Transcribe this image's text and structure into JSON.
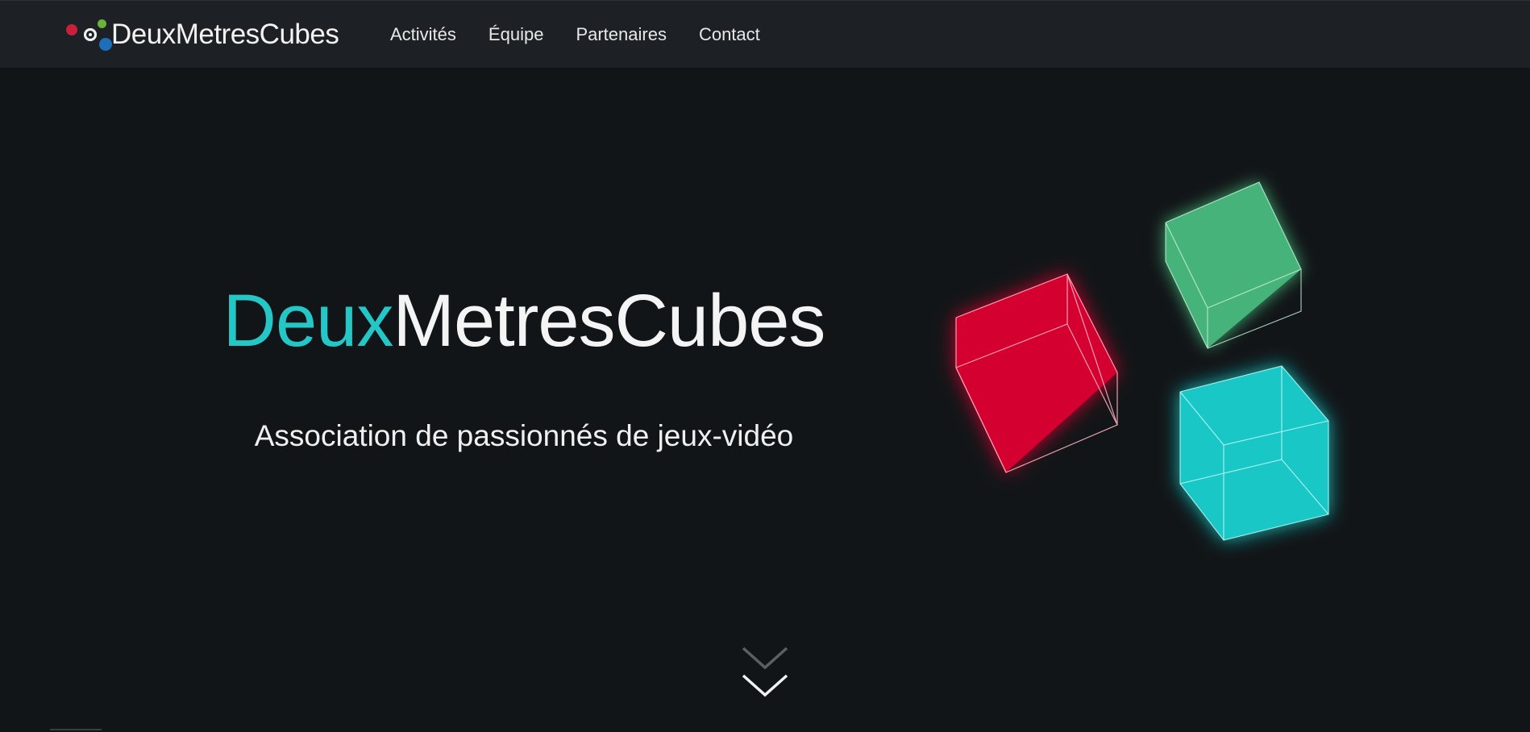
{
  "navbar": {
    "brand": "DeuxMetresCubes",
    "links": [
      {
        "label": "Activités"
      },
      {
        "label": "Équipe"
      },
      {
        "label": "Partenaires"
      },
      {
        "label": "Contact"
      }
    ]
  },
  "hero": {
    "title_accent": "Deux",
    "title_main": "MetresCubes",
    "subtitle": "Association de passionnés de jeux-vidéo"
  },
  "colors": {
    "background": "#121518",
    "navbar": "#1d2125",
    "accent": "#24c6c6",
    "cube_red": "#d0002e",
    "cube_green": "#46b47a",
    "cube_cyan": "#19c8c6"
  },
  "icons": {
    "logo": "colored-dots-logo-icon",
    "scroll": "chevron-down-icon"
  }
}
